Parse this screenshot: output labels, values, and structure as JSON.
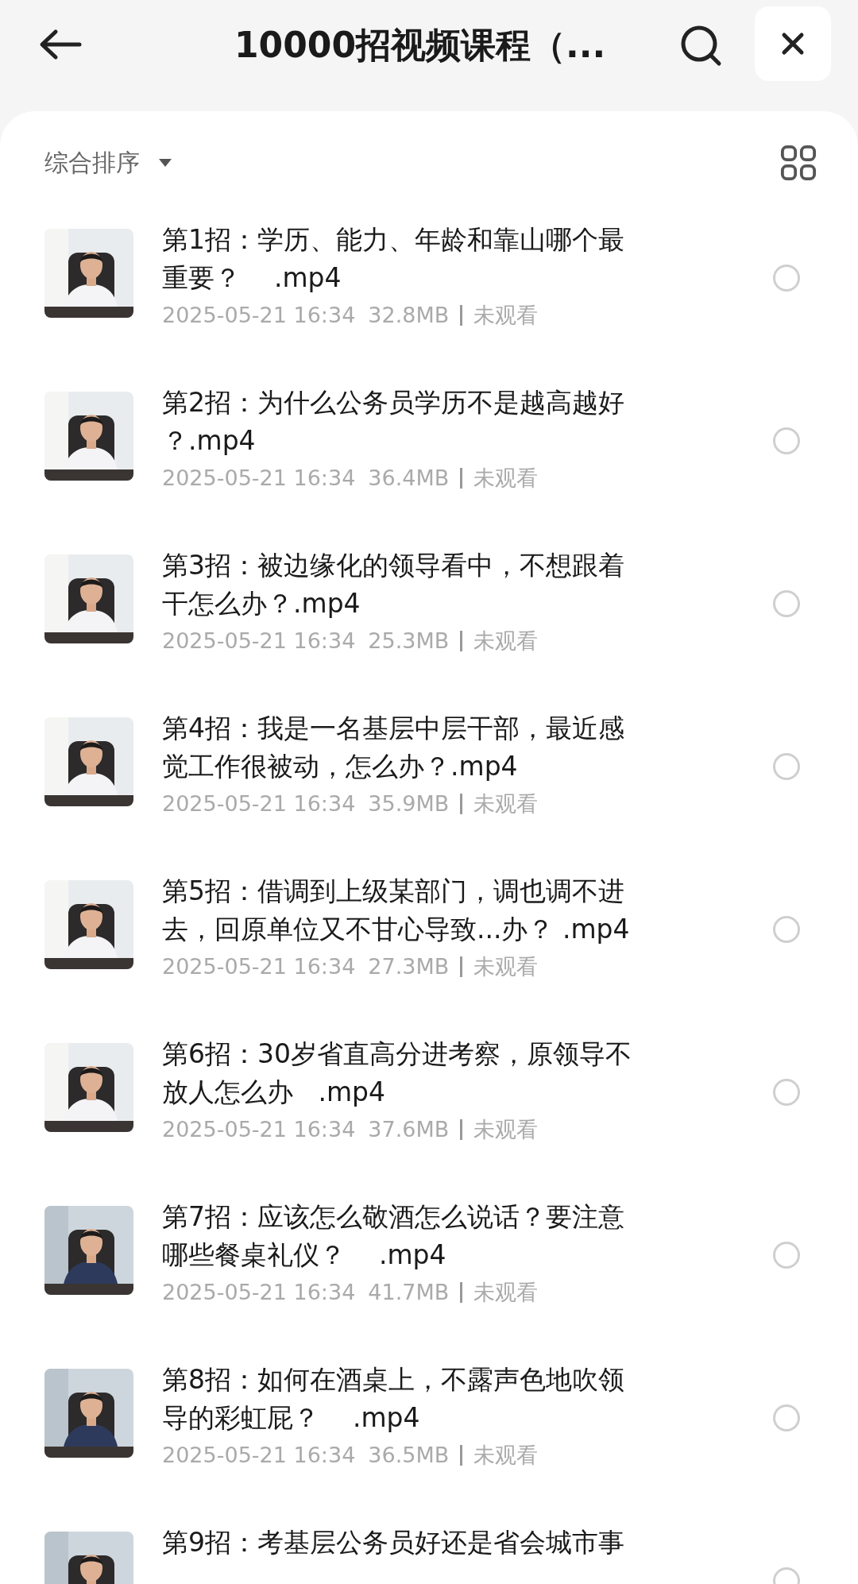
{
  "header": {
    "title": "10000招视频课程（..."
  },
  "sort": {
    "label": "综合排序"
  },
  "files": [
    {
      "title_lines": [
        "第1招：学历、能力、年龄和靠山哪个最",
        "重要？    .mp4"
      ],
      "date": "2025-05-21 16:34",
      "size": "32.8MB",
      "status": "未观看",
      "selected": false
    },
    {
      "title_lines": [
        "第2招：为什么公务员学历不是越高越好",
        "？.mp4"
      ],
      "date": "2025-05-21 16:34",
      "size": "36.4MB",
      "status": "未观看",
      "selected": false
    },
    {
      "title_lines": [
        "第3招：被边缘化的领导看中，不想跟着",
        "干怎么办？.mp4"
      ],
      "date": "2025-05-21 16:34",
      "size": "25.3MB",
      "status": "未观看",
      "selected": false
    },
    {
      "title_lines": [
        "第4招：我是一名基层中层干部，最近感",
        "觉工作很被动，怎么办？.mp4"
      ],
      "date": "2025-05-21 16:34",
      "size": "35.9MB",
      "status": "未观看",
      "selected": false
    },
    {
      "title_lines": [
        "第5招：借调到上级某部门，调也调不进",
        "去，回原单位又不甘心导致...办？ .mp4"
      ],
      "date": "2025-05-21 16:34",
      "size": "27.3MB",
      "status": "未观看",
      "selected": false
    },
    {
      "title_lines": [
        "第6招：30岁省直高分进考察，原领导不",
        "放人怎么办   .mp4"
      ],
      "date": "2025-05-21 16:34",
      "size": "37.6MB",
      "status": "未观看",
      "selected": false
    },
    {
      "title_lines": [
        "第7招：应该怎么敬酒怎么说话？要注意",
        "哪些餐桌礼仪？    .mp4"
      ],
      "date": "2025-05-21 16:34",
      "size": "41.7MB",
      "status": "未观看",
      "selected": false
    },
    {
      "title_lines": [
        "第8招：如何在酒桌上，不露声色地吹领",
        "导的彩虹屁？    .mp4"
      ],
      "date": "2025-05-21 16:34",
      "size": "36.5MB",
      "status": "未观看",
      "selected": false
    },
    {
      "title_lines": [
        "第9招：考基层公务员好还是省会城市事"
      ],
      "selected": false
    }
  ]
}
